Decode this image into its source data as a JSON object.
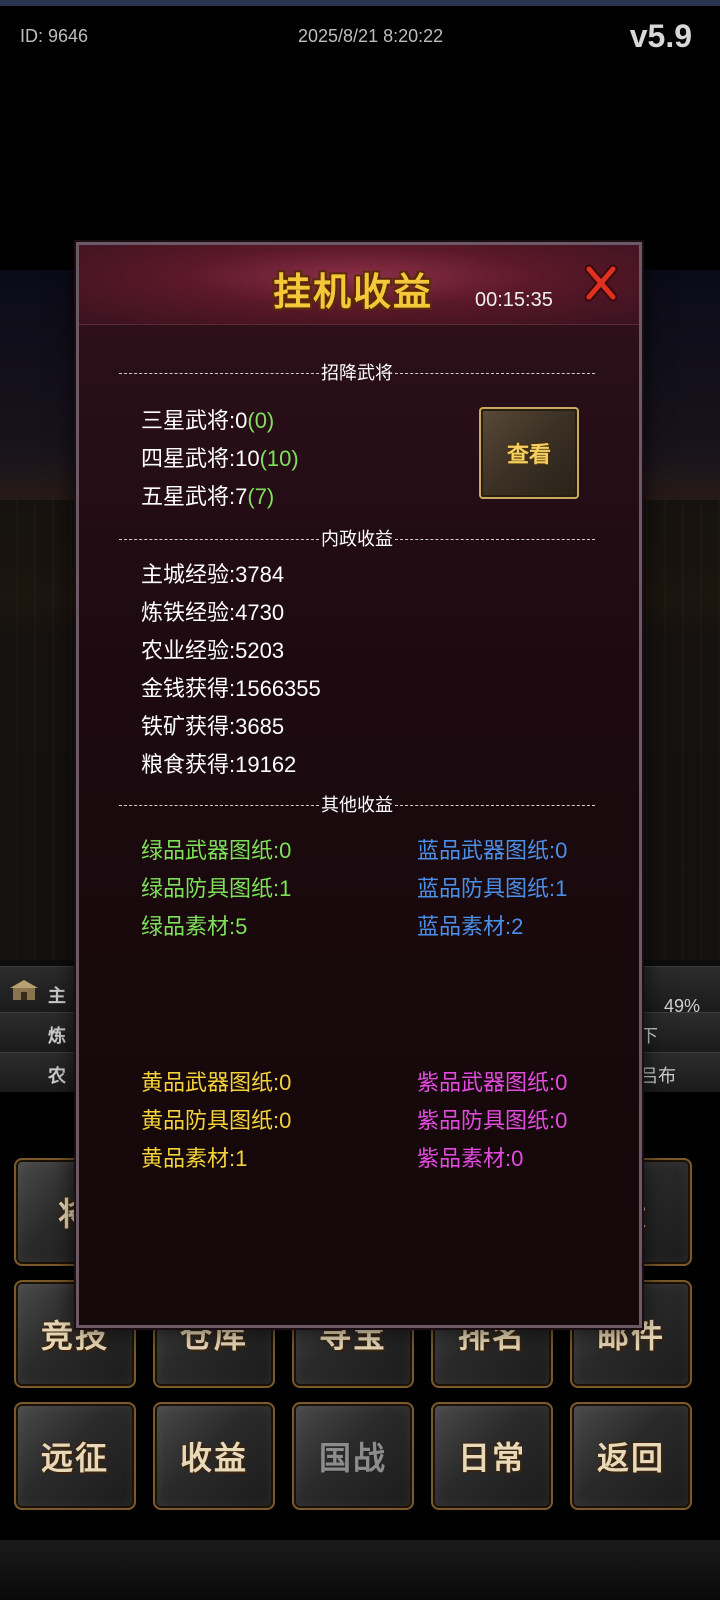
{
  "topbar": {
    "id_text": "ID: 9646",
    "datetime": "2025/8/21 8:20:22",
    "version": "v5.9"
  },
  "background": {
    "status_rows": [
      {
        "left_text": "主",
        "right_text": "49%"
      },
      {
        "left_text": "炼",
        "right_text": "下"
      },
      {
        "left_text": "农",
        "right_text": "吕布"
      }
    ]
  },
  "menu": {
    "row1": [
      {
        "label": "将"
      },
      {
        "label": "役"
      }
    ],
    "row2": [
      {
        "label": "竞技"
      },
      {
        "label": "仓库"
      },
      {
        "label": "寻宝"
      },
      {
        "label": "排名"
      },
      {
        "label": "邮件"
      }
    ],
    "row3": [
      {
        "label": "远征"
      },
      {
        "label": "收益"
      },
      {
        "label": "国战"
      },
      {
        "label": "日常"
      },
      {
        "label": "返回"
      }
    ]
  },
  "modal": {
    "title": "挂机收益",
    "timer": "00:15:35",
    "view_button": "查看",
    "sections": {
      "recruit": "招降武将",
      "domestic": "内政收益",
      "other": "其他收益"
    },
    "recruit_items": [
      {
        "label": "三星武将:",
        "value": "0",
        "extra": "(0)"
      },
      {
        "label": "四星武将:",
        "value": "10",
        "extra": "(10)"
      },
      {
        "label": "五星武将:",
        "value": "7",
        "extra": "(7)"
      }
    ],
    "domestic_items": [
      {
        "text": "主城经验:3784"
      },
      {
        "text": "炼铁经验:4730"
      },
      {
        "text": "农业经验:5203"
      },
      {
        "text": "金钱获得:1566355"
      },
      {
        "text": "铁矿获得:3685"
      },
      {
        "text": "粮食获得:19162"
      }
    ],
    "green_items": [
      "绿品武器图纸:0",
      "绿品防具图纸:1",
      "绿品素材:5"
    ],
    "blue_items": [
      "蓝品武器图纸:0",
      "蓝品防具图纸:1",
      "蓝品素材:2"
    ],
    "yellow_items": [
      "黄品武器图纸:0",
      "黄品防具图纸:0",
      "黄品素材:1"
    ],
    "purple_items": [
      "紫品武器图纸:0",
      "紫品防具图纸:0",
      "紫品素材:0"
    ]
  },
  "colors": {
    "green": "#7ee05a",
    "blue": "#4a8fe8",
    "yellow": "#f5d23a",
    "purple": "#e24ae0",
    "title_gold": "#f5c83a"
  }
}
